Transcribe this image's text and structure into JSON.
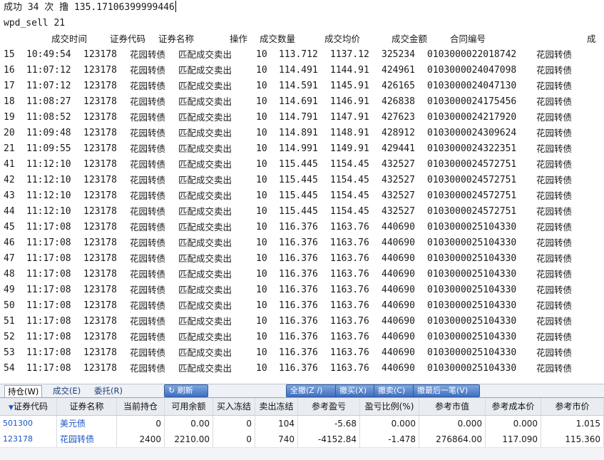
{
  "console": {
    "line1": "成功 34 次 撸 135.17106399999446",
    "line2": "wpd_sell 21",
    "headers": [
      "成交时间",
      "证券代码",
      "证券名称",
      "操作",
      "成交数量",
      "成交均价",
      "成交金额",
      "合同编号",
      "成"
    ],
    "rows": [
      [
        "15",
        "10:49:54",
        "123178",
        "花园转债",
        "匹配成交卖出",
        "10",
        "113.712",
        "1137.12",
        "325234",
        "0103000022018742",
        "花园转债"
      ],
      [
        "16",
        "11:07:12",
        "123178",
        "花园转债",
        "匹配成交卖出",
        "10",
        "114.491",
        "1144.91",
        "424961",
        "0103000024047098",
        "花园转债"
      ],
      [
        "17",
        "11:07:12",
        "123178",
        "花园转债",
        "匹配成交卖出",
        "10",
        "114.591",
        "1145.91",
        "426165",
        "0103000024047130",
        "花园转债"
      ],
      [
        "18",
        "11:08:27",
        "123178",
        "花园转债",
        "匹配成交卖出",
        "10",
        "114.691",
        "1146.91",
        "426838",
        "0103000024175456",
        "花园转债"
      ],
      [
        "19",
        "11:08:52",
        "123178",
        "花园转债",
        "匹配成交卖出",
        "10",
        "114.791",
        "1147.91",
        "427623",
        "0103000024217920",
        "花园转债"
      ],
      [
        "20",
        "11:09:48",
        "123178",
        "花园转债",
        "匹配成交卖出",
        "10",
        "114.891",
        "1148.91",
        "428912",
        "0103000024309624",
        "花园转债"
      ],
      [
        "21",
        "11:09:55",
        "123178",
        "花园转债",
        "匹配成交卖出",
        "10",
        "114.991",
        "1149.91",
        "429441",
        "0103000024322351",
        "花园转债"
      ],
      [
        "41",
        "11:12:10",
        "123178",
        "花园转债",
        "匹配成交卖出",
        "10",
        "115.445",
        "1154.45",
        "432527",
        "0103000024572751",
        "花园转债"
      ],
      [
        "42",
        "11:12:10",
        "123178",
        "花园转债",
        "匹配成交卖出",
        "10",
        "115.445",
        "1154.45",
        "432527",
        "0103000024572751",
        "花园转债"
      ],
      [
        "43",
        "11:12:10",
        "123178",
        "花园转债",
        "匹配成交卖出",
        "10",
        "115.445",
        "1154.45",
        "432527",
        "0103000024572751",
        "花园转债"
      ],
      [
        "44",
        "11:12:10",
        "123178",
        "花园转债",
        "匹配成交卖出",
        "10",
        "115.445",
        "1154.45",
        "432527",
        "0103000024572751",
        "花园转债"
      ],
      [
        "45",
        "11:17:08",
        "123178",
        "花园转债",
        "匹配成交卖出",
        "10",
        "116.376",
        "1163.76",
        "440690",
        "0103000025104330",
        "花园转债"
      ],
      [
        "46",
        "11:17:08",
        "123178",
        "花园转债",
        "匹配成交卖出",
        "10",
        "116.376",
        "1163.76",
        "440690",
        "0103000025104330",
        "花园转债"
      ],
      [
        "47",
        "11:17:08",
        "123178",
        "花园转债",
        "匹配成交卖出",
        "10",
        "116.376",
        "1163.76",
        "440690",
        "0103000025104330",
        "花园转债"
      ],
      [
        "48",
        "11:17:08",
        "123178",
        "花园转债",
        "匹配成交卖出",
        "10",
        "116.376",
        "1163.76",
        "440690",
        "0103000025104330",
        "花园转债"
      ],
      [
        "49",
        "11:17:08",
        "123178",
        "花园转债",
        "匹配成交卖出",
        "10",
        "116.376",
        "1163.76",
        "440690",
        "0103000025104330",
        "花园转债"
      ],
      [
        "50",
        "11:17:08",
        "123178",
        "花园转债",
        "匹配成交卖出",
        "10",
        "116.376",
        "1163.76",
        "440690",
        "0103000025104330",
        "花园转债"
      ],
      [
        "51",
        "11:17:08",
        "123178",
        "花园转债",
        "匹配成交卖出",
        "10",
        "116.376",
        "1163.76",
        "440690",
        "0103000025104330",
        "花园转债"
      ],
      [
        "52",
        "11:17:08",
        "123178",
        "花园转债",
        "匹配成交卖出",
        "10",
        "116.376",
        "1163.76",
        "440690",
        "0103000025104330",
        "花园转债"
      ],
      [
        "53",
        "11:17:08",
        "123178",
        "花园转债",
        "匹配成交卖出",
        "10",
        "116.376",
        "1163.76",
        "440690",
        "0103000025104330",
        "花园转债"
      ],
      [
        "54",
        "11:17:08",
        "123178",
        "花园转债",
        "匹配成交卖出",
        "10",
        "116.376",
        "1163.76",
        "440690",
        "0103000025104330",
        "花园转债"
      ]
    ]
  },
  "panel": {
    "tabs": [
      "持仓(W)",
      "成交(E)",
      "委托(R)"
    ],
    "buttons": {
      "refresh": "刷新",
      "cancel_all": "全撤(Z /)",
      "cancel_buy": "撤买(X)",
      "cancel_sell": "撤卖(C)",
      "cancel_last": "撤最后一笔(V)"
    },
    "icons": {
      "refresh": "refresh-icon",
      "sort": "sort-desc-icon"
    },
    "columns": [
      "证券代码",
      "证券名称",
      "当前持仓",
      "可用余额",
      "买入冻结",
      "卖出冻结",
      "参考盈亏",
      "盈亏比例(%)",
      "参考市值",
      "参考成本价",
      "参考市价"
    ],
    "rows": [
      [
        "501300",
        "美元债",
        "0",
        "0.00",
        "0",
        "104",
        "-5.68",
        "0.000",
        "0.000",
        "0.000",
        "1.015"
      ],
      [
        "123178",
        "花园转债",
        "2400",
        "2210.00",
        "0",
        "740",
        "-4152.84",
        "-1.478",
        "276864.00",
        "117.090",
        "115.360"
      ]
    ]
  }
}
